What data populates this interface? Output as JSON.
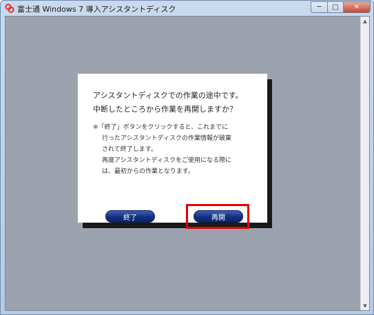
{
  "window": {
    "title": "富士通 Windows 7 導入アシスタントディスク",
    "controls": {
      "minimize": "─",
      "maximize": "□",
      "close": "✕"
    }
  },
  "dialog": {
    "message_lines": [
      "アシスタントディスクでの作業の途中です。",
      "中断したところから作業を再開しますか？"
    ],
    "note_lines": [
      "※「終了」ボタンをクリックすると、これまでに",
      "行ったアシスタントディスクの作業情報が破棄",
      "されて終了します。",
      "再度アシスタントディスクをご使用になる際に",
      "は、最初からの作業となります。"
    ],
    "end_button": "終了",
    "resume_button": "再開"
  },
  "colors": {
    "background": "#9da3ae",
    "button": "#14307e",
    "highlight": "#e00000"
  }
}
